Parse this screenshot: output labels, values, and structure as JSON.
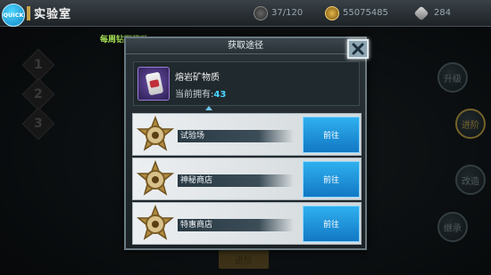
{
  "topbar": {
    "quick_label": "QUICK",
    "title": "实验室",
    "stamina": "37/120",
    "gold": "55075485",
    "diamonds": "284"
  },
  "background": {
    "reward_banner": "每周钻石奖励",
    "steps": [
      "1",
      "2",
      "3"
    ],
    "side_buttons": [
      "升级",
      "进阶",
      "改造",
      "继承"
    ],
    "bottom_button": "进阶"
  },
  "dialog": {
    "title": "获取途径",
    "item": {
      "name": "熔岩矿物质",
      "owned_label": "当前拥有:",
      "owned_count": "43"
    },
    "sources": [
      {
        "name": "试验场",
        "button": "前往"
      },
      {
        "name": "神秘商店",
        "button": "前往"
      },
      {
        "name": "特惠商店",
        "button": "前往"
      }
    ]
  },
  "colors": {
    "accent_blue": "#1e90d8",
    "owned_count": "#49d7ff",
    "reward_green": "#a8e255"
  }
}
